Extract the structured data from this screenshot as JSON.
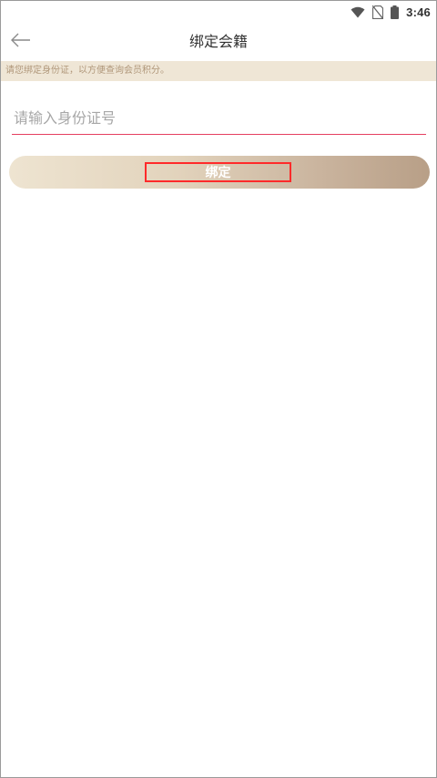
{
  "status_bar": {
    "time": "3:46",
    "icons": [
      "wifi-icon",
      "no-sim-icon",
      "battery-icon"
    ]
  },
  "header": {
    "title": "绑定会籍",
    "back_icon": "back-arrow-icon"
  },
  "notice": {
    "text": "请您绑定身份证，以方便查询会员积分。"
  },
  "form": {
    "id_input": {
      "value": "",
      "placeholder": "请输入身份证号"
    },
    "bind_button_label": "绑定"
  },
  "colors": {
    "accent_underline": "#e53e5f",
    "notice_bg": "#efe6d6",
    "notice_text": "#b0977a",
    "button_gradient_start": "#eee4d1",
    "button_gradient_end": "#b89f87",
    "highlight_box": "#ff2a2a"
  }
}
